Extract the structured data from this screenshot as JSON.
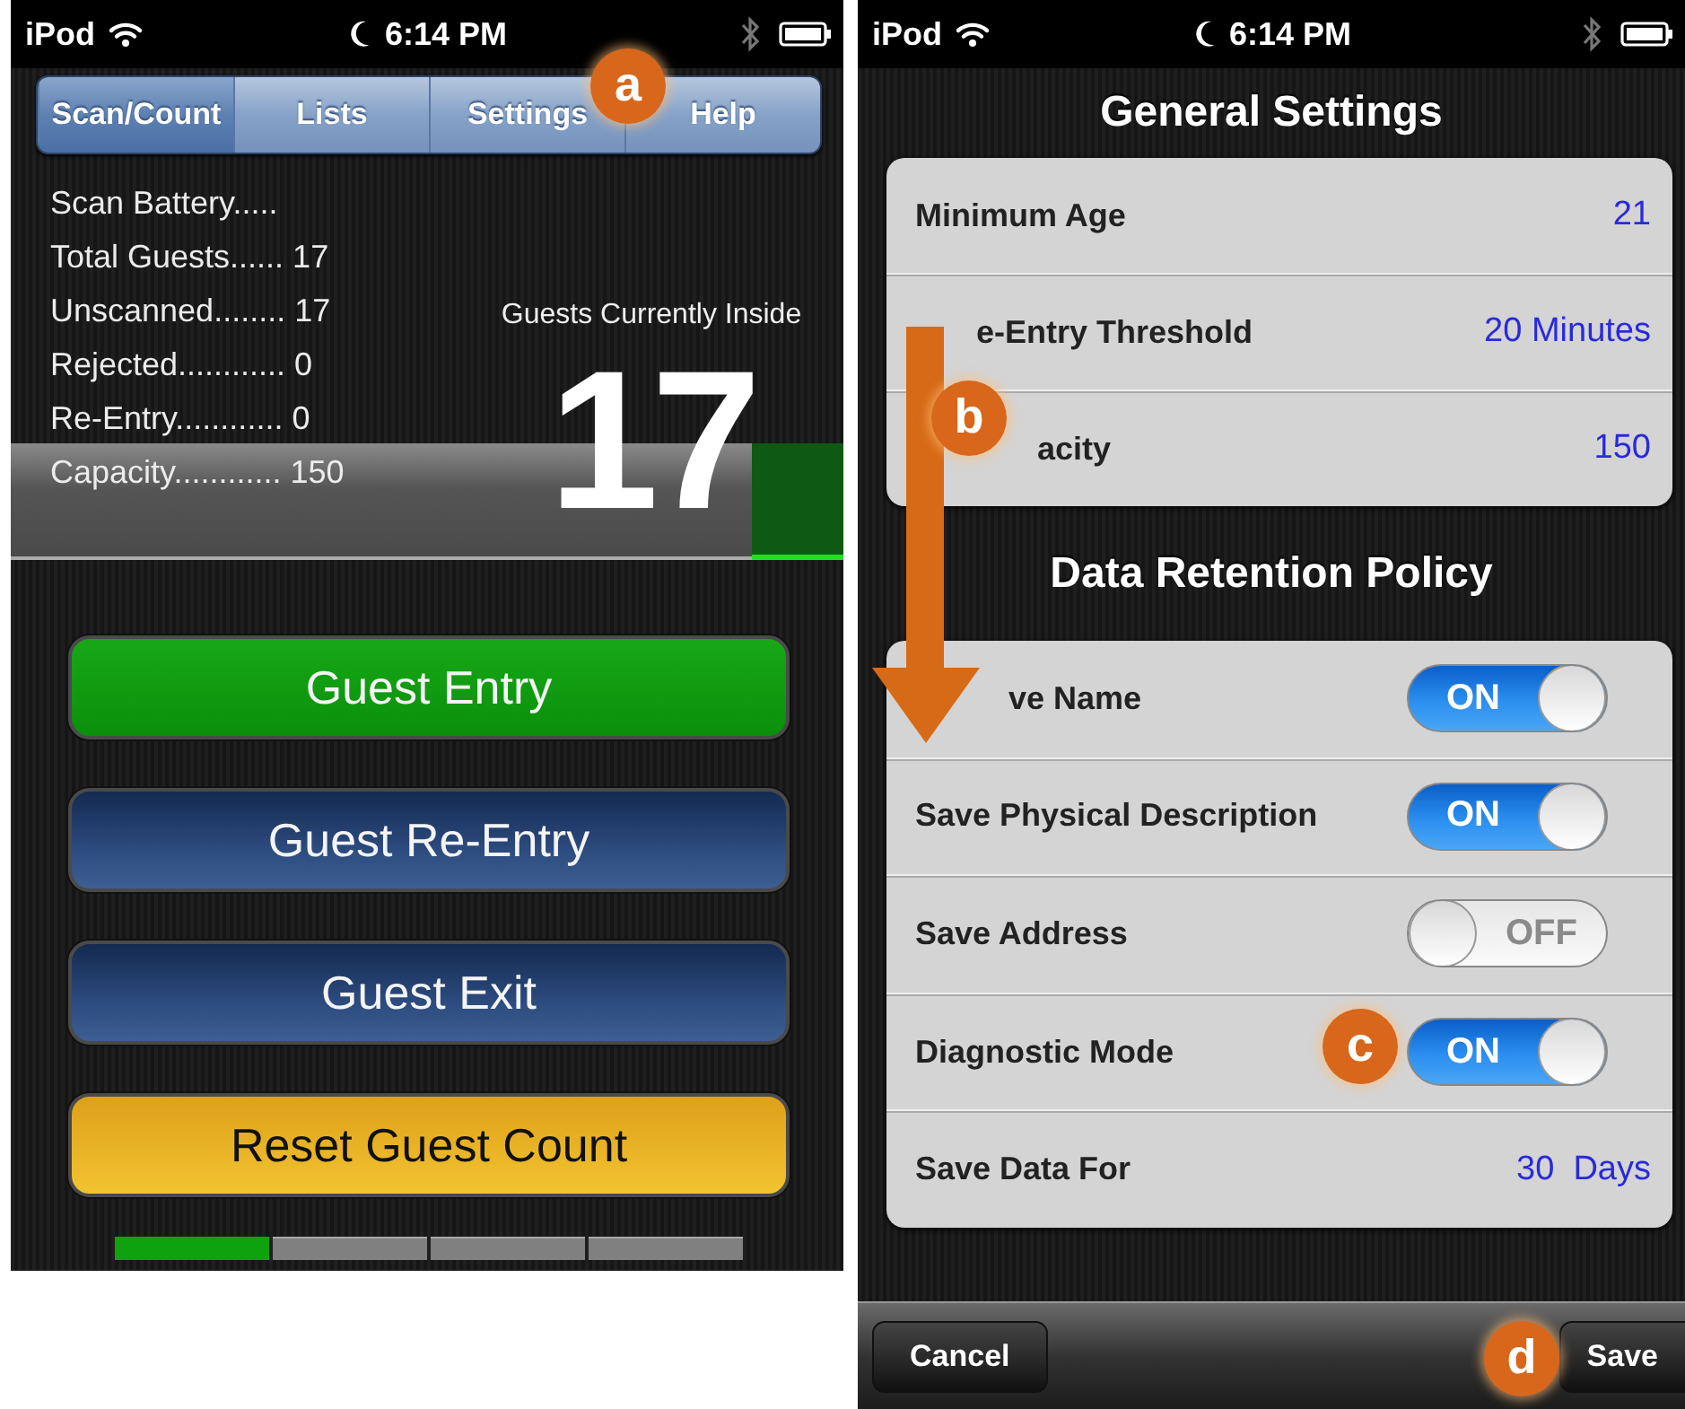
{
  "left_screen": {
    "status_bar": {
      "carrier": "iPod",
      "time": "6:14 PM"
    },
    "tabs": [
      {
        "label": "Scan/Count",
        "selected": true
      },
      {
        "label": "Lists",
        "selected": false
      },
      {
        "label": "Settings",
        "selected": false
      },
      {
        "label": "Help",
        "selected": false
      }
    ],
    "stats": [
      "Scan Battery.....",
      "Total Guests...... 17",
      "Unscanned........ 17",
      "Rejected............ 0",
      "Re-Entry............ 0",
      "Capacity............ 150"
    ],
    "inside_label": "Guests Currently Inside",
    "inside_count": "17",
    "capacity_meter": {
      "level": 0.11
    },
    "buttons": [
      {
        "label": "Guest Entry",
        "kind": "entry"
      },
      {
        "label": "Guest Re-Entry",
        "kind": "nav"
      },
      {
        "label": "Guest Exit",
        "kind": "nav"
      },
      {
        "label": "Reset Guest Count",
        "kind": "reset"
      }
    ],
    "pages": [
      {
        "selected": true
      },
      {
        "selected": false
      },
      {
        "selected": false
      },
      {
        "selected": false
      }
    ]
  },
  "right_screen": {
    "status_bar": {
      "carrier": "iPod",
      "time": "6:14 PM"
    },
    "sections": [
      {
        "title": "General Settings",
        "rows": [
          {
            "kind": "value",
            "label": "Minimum Age",
            "value": "21"
          },
          {
            "kind": "value",
            "label": "e-Entry Threshold",
            "value": "20 Minutes"
          },
          {
            "kind": "value",
            "label": "acity",
            "value": "150"
          }
        ]
      },
      {
        "title": "Data Retention Policy",
        "rows": [
          {
            "kind": "toggle",
            "label": "ve Name",
            "on": true,
            "switch_text": "ON"
          },
          {
            "kind": "toggle",
            "label": "Save Physical Description",
            "on": true,
            "switch_text": "ON"
          },
          {
            "kind": "toggle",
            "label": "Save Address",
            "on": false,
            "switch_text": "OFF"
          },
          {
            "kind": "toggle",
            "label": "Diagnostic Mode",
            "on": true,
            "switch_text": "ON"
          },
          {
            "kind": "value",
            "label": "Save Data For",
            "value": "30  Days"
          }
        ]
      }
    ],
    "toolbar": {
      "cancel": "Cancel",
      "save": "Save"
    }
  },
  "callouts": [
    "a",
    "b",
    "c",
    "d"
  ]
}
